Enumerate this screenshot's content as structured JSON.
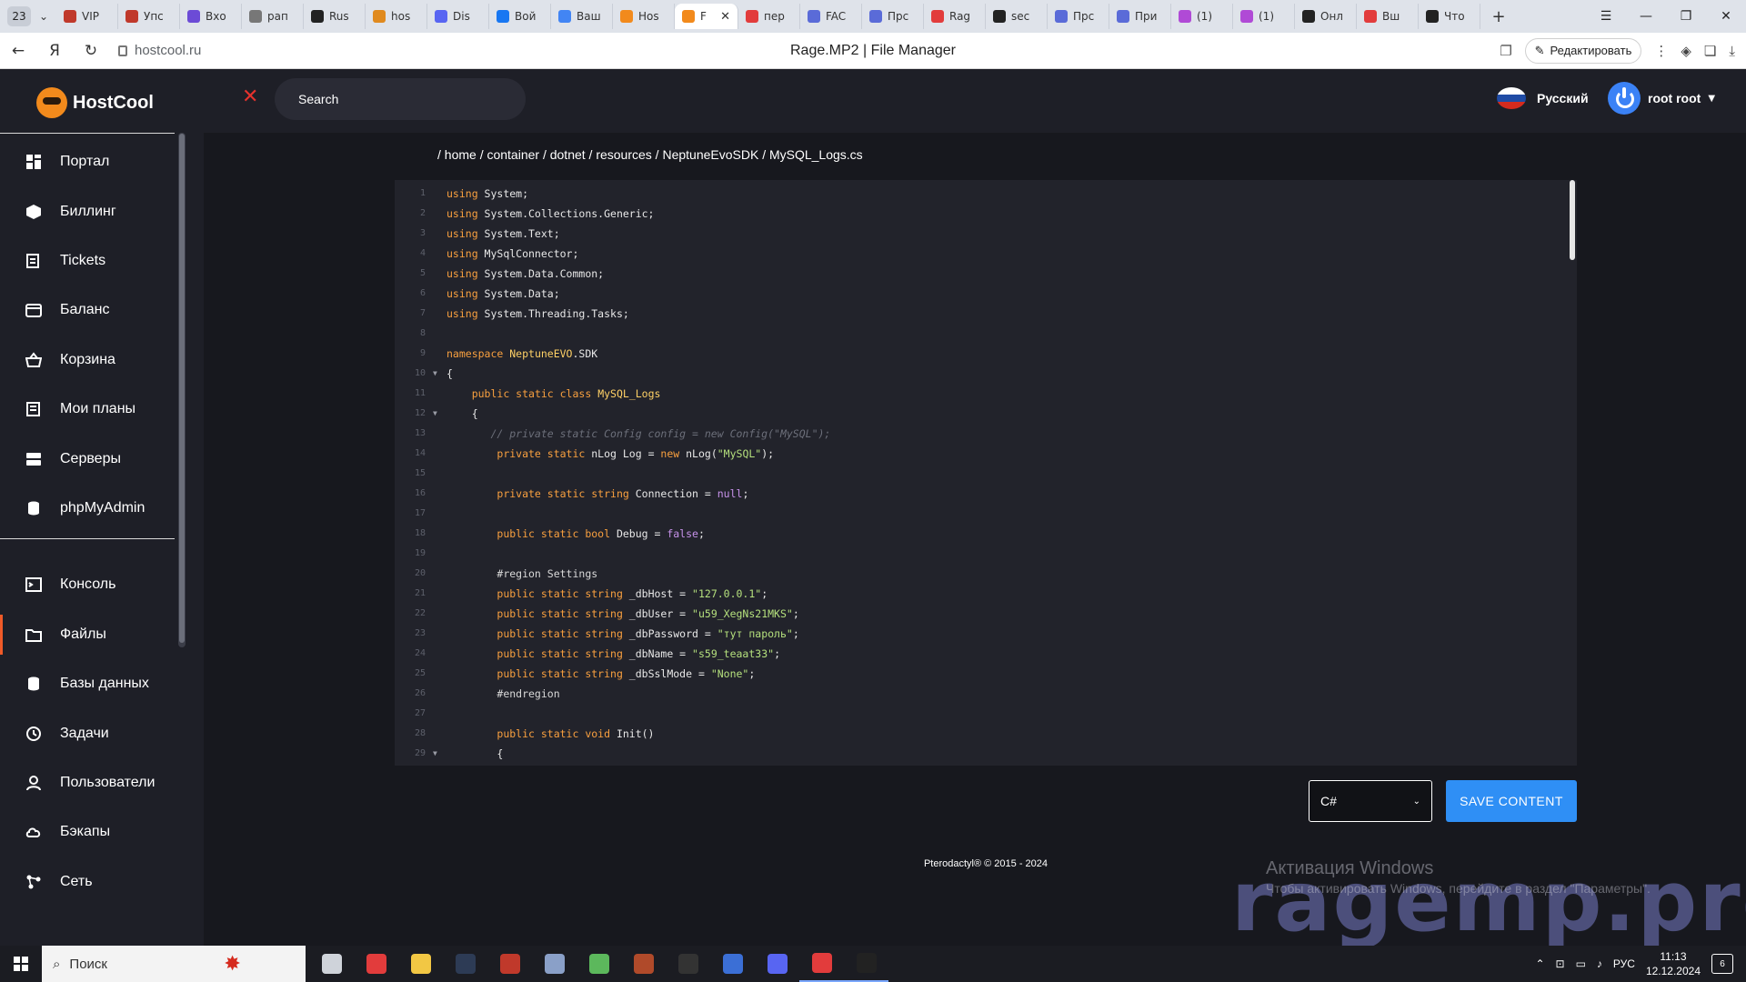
{
  "browser": {
    "tab_count": "23",
    "tabs": [
      {
        "label": "VIP",
        "color": "#c0392b"
      },
      {
        "label": "Упс",
        "color": "#c0392b"
      },
      {
        "label": "Вхо",
        "color": "#6c4bd6"
      },
      {
        "label": "рап",
        "color": "#777777"
      },
      {
        "label": "Rus",
        "color": "#222222"
      },
      {
        "label": "hos",
        "color": "#e08a1e"
      },
      {
        "label": "Dis",
        "color": "#5865f2"
      },
      {
        "label": "Вой",
        "color": "#1877f2"
      },
      {
        "label": "Ваш",
        "color": "#4285f4"
      },
      {
        "label": "Hos",
        "color": "#f28a1c"
      },
      {
        "label": "F",
        "color": "#f28a1c",
        "active": true
      },
      {
        "label": "пер",
        "color": "#e23c3c"
      },
      {
        "label": "FAC",
        "color": "#5a6bd8"
      },
      {
        "label": "Прс",
        "color": "#5a6bd8"
      },
      {
        "label": "Rag",
        "color": "#e23c3c"
      },
      {
        "label": "sec",
        "color": "#222222"
      },
      {
        "label": "Прс",
        "color": "#5a6bd8"
      },
      {
        "label": "При",
        "color": "#5a6bd8"
      },
      {
        "label": "(1)",
        "color": "#b04ad6"
      },
      {
        "label": "(1)",
        "color": "#b04ad6"
      },
      {
        "label": "Онл",
        "color": "#222222"
      },
      {
        "label": "Вш",
        "color": "#e23c3c"
      },
      {
        "label": "Что",
        "color": "#222222"
      }
    ],
    "url": "hostcool.ru",
    "page_title": "Rage.MP2 | File Manager",
    "edit_label": "Редактировать"
  },
  "header": {
    "brand": "HostCool",
    "search_placeholder": "Search",
    "language": "Русский",
    "user": "root root"
  },
  "sidebar": {
    "items": [
      {
        "label": "Портал",
        "icon": "dashboard-icon"
      },
      {
        "label": "Биллинг",
        "icon": "box-icon"
      },
      {
        "label": "Tickets",
        "icon": "ticket-icon"
      },
      {
        "label": "Баланс",
        "icon": "wallet-icon"
      },
      {
        "label": "Корзина",
        "icon": "basket-icon"
      },
      {
        "label": "Мои планы",
        "icon": "plans-icon"
      },
      {
        "label": "Серверы",
        "icon": "server-icon"
      },
      {
        "label": "phpMyAdmin",
        "icon": "database-icon"
      },
      {
        "label": "Консоль",
        "icon": "console-icon"
      },
      {
        "label": "Файлы",
        "icon": "folder-icon",
        "active": true
      },
      {
        "label": "Базы данных",
        "icon": "database-icon"
      },
      {
        "label": "Задачи",
        "icon": "clock-icon"
      },
      {
        "label": "Пользователи",
        "icon": "user-icon"
      },
      {
        "label": "Бэкапы",
        "icon": "cloud-icon"
      },
      {
        "label": "Сеть",
        "icon": "network-icon"
      }
    ]
  },
  "file": {
    "breadcrumb": "/ home / container / dotnet / resources / NeptuneEvoSDK / MySQL_Logs.cs",
    "lines": [
      {
        "n": "1",
        "fold": false,
        "tokens": [
          [
            "kw",
            "using"
          ],
          [
            "",
            " System;"
          ]
        ]
      },
      {
        "n": "2",
        "fold": false,
        "tokens": [
          [
            "kw",
            "using"
          ],
          [
            "",
            " System.Collections.Generic;"
          ]
        ]
      },
      {
        "n": "3",
        "fold": false,
        "tokens": [
          [
            "kw",
            "using"
          ],
          [
            "",
            " System.Text;"
          ]
        ]
      },
      {
        "n": "4",
        "fold": false,
        "tokens": [
          [
            "kw",
            "using"
          ],
          [
            "",
            " MySqlConnector;"
          ]
        ]
      },
      {
        "n": "5",
        "fold": false,
        "tokens": [
          [
            "kw",
            "using"
          ],
          [
            "",
            " System.Data.Common;"
          ]
        ]
      },
      {
        "n": "6",
        "fold": false,
        "tokens": [
          [
            "kw",
            "using"
          ],
          [
            "",
            " System.Data;"
          ]
        ]
      },
      {
        "n": "7",
        "fold": false,
        "tokens": [
          [
            "kw",
            "using"
          ],
          [
            "",
            " System.Threading.Tasks;"
          ]
        ]
      },
      {
        "n": "8",
        "fold": false,
        "tokens": []
      },
      {
        "n": "9",
        "fold": false,
        "tokens": [
          [
            "kw",
            "namespace"
          ],
          [
            "",
            " "
          ],
          [
            "cls",
            "NeptuneEVO"
          ],
          [
            "",
            ".SDK"
          ]
        ]
      },
      {
        "n": "10",
        "fold": true,
        "tokens": [
          [
            "",
            "{"
          ]
        ]
      },
      {
        "n": "11",
        "fold": false,
        "tokens": [
          [
            "",
            "    "
          ],
          [
            "kw",
            "public static class"
          ],
          [
            "",
            " "
          ],
          [
            "cls",
            "MySQL_Logs"
          ]
        ]
      },
      {
        "n": "12",
        "fold": true,
        "tokens": [
          [
            "",
            "    {"
          ]
        ]
      },
      {
        "n": "13",
        "fold": false,
        "tokens": [
          [
            "",
            "       "
          ],
          [
            "cmt",
            "// private static Config config = new Config(\"MySQL\");"
          ]
        ]
      },
      {
        "n": "14",
        "fold": false,
        "tokens": [
          [
            "",
            "        "
          ],
          [
            "kw",
            "private static"
          ],
          [
            "",
            " nLog Log = "
          ],
          [
            "kw",
            "new"
          ],
          [
            "",
            " nLog("
          ],
          [
            "str",
            "\"MySQL\""
          ],
          [
            "",
            ");"
          ]
        ]
      },
      {
        "n": "15",
        "fold": false,
        "tokens": []
      },
      {
        "n": "16",
        "fold": false,
        "tokens": [
          [
            "",
            "        "
          ],
          [
            "kw",
            "private static string"
          ],
          [
            "",
            " Connection = "
          ],
          [
            "lit",
            "null"
          ],
          [
            "",
            ";"
          ]
        ]
      },
      {
        "n": "17",
        "fold": false,
        "tokens": []
      },
      {
        "n": "18",
        "fold": false,
        "tokens": [
          [
            "",
            "        "
          ],
          [
            "kw",
            "public static bool"
          ],
          [
            "",
            " Debug = "
          ],
          [
            "lit",
            "false"
          ],
          [
            "",
            ";"
          ]
        ]
      },
      {
        "n": "19",
        "fold": false,
        "tokens": []
      },
      {
        "n": "20",
        "fold": false,
        "tokens": [
          [
            "",
            "        "
          ],
          [
            "pre",
            "#region Settings"
          ]
        ]
      },
      {
        "n": "21",
        "fold": false,
        "tokens": [
          [
            "",
            "        "
          ],
          [
            "kw",
            "public static string"
          ],
          [
            "",
            " _dbHost = "
          ],
          [
            "str",
            "\"127.0.0.1\""
          ],
          [
            "",
            ";"
          ]
        ]
      },
      {
        "n": "22",
        "fold": false,
        "tokens": [
          [
            "",
            "        "
          ],
          [
            "kw",
            "public static string"
          ],
          [
            "",
            " _dbUser = "
          ],
          [
            "str",
            "\"u59_XegNs21MKS\""
          ],
          [
            "",
            ";"
          ]
        ]
      },
      {
        "n": "23",
        "fold": false,
        "tokens": [
          [
            "",
            "        "
          ],
          [
            "kw",
            "public static string"
          ],
          [
            "",
            " _dbPassword = "
          ],
          [
            "str",
            "\"тут пароль\""
          ],
          [
            "",
            ";"
          ]
        ]
      },
      {
        "n": "24",
        "fold": false,
        "tokens": [
          [
            "",
            "        "
          ],
          [
            "kw",
            "public static string"
          ],
          [
            "",
            " _dbName = "
          ],
          [
            "str",
            "\"s59_teaat33\""
          ],
          [
            "",
            ";"
          ]
        ]
      },
      {
        "n": "25",
        "fold": false,
        "tokens": [
          [
            "",
            "        "
          ],
          [
            "kw",
            "public static string"
          ],
          [
            "",
            " _dbSslMode = "
          ],
          [
            "str",
            "\"None\""
          ],
          [
            "",
            ";"
          ]
        ]
      },
      {
        "n": "26",
        "fold": false,
        "tokens": [
          [
            "",
            "        "
          ],
          [
            "pre",
            "#endregion"
          ]
        ]
      },
      {
        "n": "27",
        "fold": false,
        "tokens": []
      },
      {
        "n": "28",
        "fold": false,
        "tokens": [
          [
            "",
            "        "
          ],
          [
            "kw",
            "public static void"
          ],
          [
            "",
            " Init()"
          ]
        ]
      },
      {
        "n": "29",
        "fold": true,
        "tokens": [
          [
            "",
            "        {"
          ]
        ]
      }
    ],
    "syntax_language": "C#",
    "save_label": "SAVE CONTENT",
    "footer": "Pterodactyl® © 2015 - 2024"
  },
  "watermark": {
    "activation_title": "Активация Windows",
    "activation_text": "Чтобы активировать Windows, перейдите в раздел \"Параметры\".",
    "site": "ragemp.pro"
  },
  "taskbar": {
    "search_placeholder": "Поиск",
    "apps": [
      {
        "name": "task-view",
        "color": "#cfd3da"
      },
      {
        "name": "yandex",
        "color": "#e23c3c"
      },
      {
        "name": "explorer",
        "color": "#f2c744"
      },
      {
        "name": "terminal",
        "color": "#2d3b55"
      },
      {
        "name": "filezilla",
        "color": "#c0392b"
      },
      {
        "name": "network",
        "color": "#8aa0c8"
      },
      {
        "name": "notepad",
        "color": "#5cb85c"
      },
      {
        "name": "winrar",
        "color": "#b04a2a"
      },
      {
        "name": "epic-games",
        "color": "#333333"
      },
      {
        "name": "app",
        "color": "#3b6fd6"
      },
      {
        "name": "discord",
        "color": "#5865f2"
      },
      {
        "name": "yandex-browser",
        "color": "#e23c3c"
      },
      {
        "name": "console",
        "color": "#222222"
      }
    ],
    "lang": "РУС",
    "time": "11:13",
    "date": "12.12.2024",
    "notifications": "6"
  },
  "colors": {
    "accent": "#2f8ff5",
    "brand": "#f28a1c",
    "active_nav": "#f05a28"
  }
}
